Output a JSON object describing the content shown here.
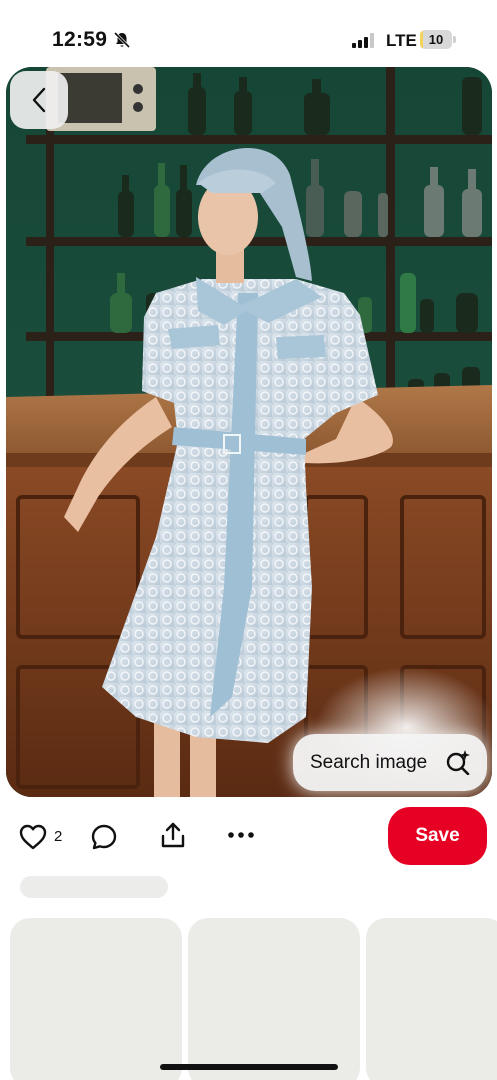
{
  "status_bar": {
    "time": "12:59",
    "network": "LTE",
    "battery_level": "10",
    "battery_fraction": 0.1,
    "signal_bars_active": 3,
    "signal_bars_total": 4,
    "silent_icon": "bell-slash-icon"
  },
  "pin": {
    "image_description_icon": "photo",
    "back_icon": "chevron-left-icon",
    "search_image_label": "Search image",
    "search_image_icon": "visual-search-sparkle-icon"
  },
  "actions": {
    "like_count": "2",
    "like_icon": "heart-icon",
    "comment_icon": "comment-icon",
    "share_icon": "share-icon",
    "more_icon": "more-icon",
    "save_label": "Save"
  },
  "colors": {
    "save_red": "#e60023",
    "battery_yellow": "#f3d35a",
    "placeholder_gray": "#ebebe8"
  }
}
